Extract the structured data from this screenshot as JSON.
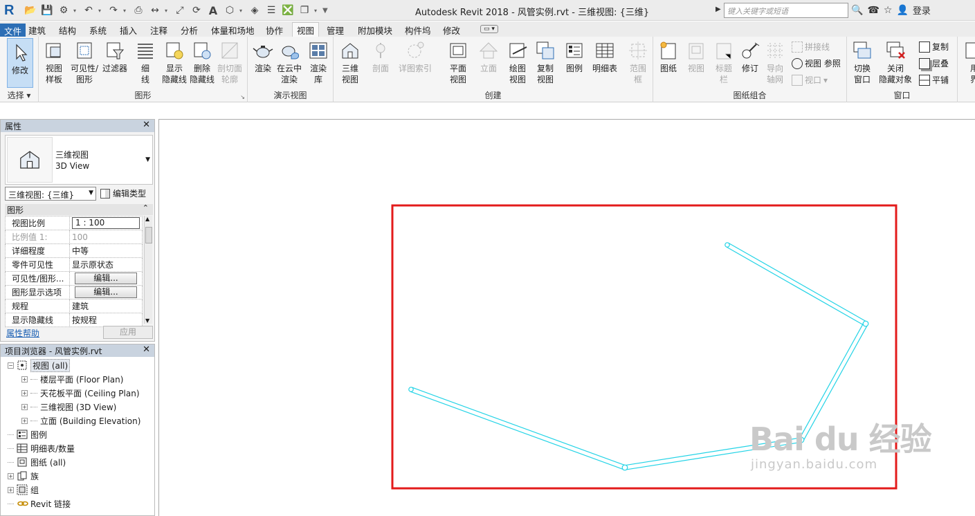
{
  "window": {
    "title": "Autodesk Revit 2018 -    风管实例.rvt - 三维视图: {三维}",
    "search_placeholder": "键入关键字或短语",
    "login": "登录"
  },
  "tabs": [
    "文件",
    "建筑",
    "结构",
    "系统",
    "插入",
    "注释",
    "分析",
    "体量和场地",
    "协作",
    "视图",
    "管理",
    "附加模块",
    "构件坞",
    "修改"
  ],
  "active_tab": "视图",
  "ribbon": {
    "panels": {
      "select": "选择",
      "graphics": "图形",
      "presentation": "演示视图",
      "create": "创建",
      "sheet": "图纸组合",
      "window": "窗口"
    },
    "buttons": {
      "modify": "修改",
      "view_templates": [
        "视图",
        "样板"
      ],
      "visibility": [
        "可见性/",
        "图形"
      ],
      "filters": "过滤器",
      "thin_lines": [
        "细",
        "线"
      ],
      "show_hidden": [
        "显示",
        "隐藏线"
      ],
      "remove_hidden": [
        "删除",
        "隐藏线"
      ],
      "cut_profile": [
        "剖切面",
        "轮廓"
      ],
      "render": "渲染",
      "render_cloud": [
        "在云中",
        "渲染"
      ],
      "render_gallery": [
        "渲染",
        "库"
      ],
      "view_3d": [
        "三维",
        "视图"
      ],
      "section": "剖面",
      "callout": "详图索引",
      "plan_views": [
        "平面",
        "视图"
      ],
      "elevation": "立面",
      "drafting_view": [
        "绘图",
        "视图"
      ],
      "duplicate_view": [
        "复制",
        "视图"
      ],
      "legends": "图例",
      "schedules": "明细表",
      "scope_box": [
        "范围",
        "框"
      ],
      "sheet": "图纸",
      "view": "视图",
      "title_block": [
        "标题",
        "栏"
      ],
      "revisions": "修订",
      "guide_grid": [
        "导向",
        "轴网"
      ],
      "matchline": "拼接线",
      "view_reference": "视图 参照",
      "viewports": "视口",
      "switch_windows": [
        "切换",
        "窗口"
      ],
      "close_hidden": [
        "关闭",
        "隐藏对象"
      ],
      "replicate": "复制",
      "cascade": "层叠",
      "tile": "平铺",
      "user_interface": [
        "用",
        "界"
      ]
    }
  },
  "properties": {
    "title": "属性",
    "type_name": [
      "三维视图",
      "3D View"
    ],
    "selector": "三维视图: {三维}",
    "edit_type": "编辑类型",
    "group": "图形",
    "rows": [
      {
        "key": "视图比例",
        "value": "1 : 100",
        "kind": "input"
      },
      {
        "key": "比例值 1:",
        "value": "100",
        "kind": "dim"
      },
      {
        "key": "详细程度",
        "value": "中等",
        "kind": "text"
      },
      {
        "key": "零件可见性",
        "value": "显示原状态",
        "kind": "text"
      },
      {
        "key": "可见性/图形...",
        "value": "编辑...",
        "kind": "button"
      },
      {
        "key": "图形显示选项",
        "value": "编辑...",
        "kind": "button"
      },
      {
        "key": "规程",
        "value": "建筑",
        "kind": "text"
      },
      {
        "key": "显示隐藏线",
        "value": "按规程",
        "kind": "text"
      }
    ],
    "help": "属性帮助",
    "apply": "应用"
  },
  "browser": {
    "title": "项目浏览器 - 风管实例.rvt",
    "items": [
      {
        "label": "视图 (all)",
        "level": 0,
        "toggle": "−",
        "icon": "views-icon",
        "selected": true
      },
      {
        "label": "楼层平面 (Floor Plan)",
        "level": 1,
        "toggle": "+"
      },
      {
        "label": "天花板平面 (Ceiling Plan)",
        "level": 1,
        "toggle": "+"
      },
      {
        "label": "三维视图 (3D View)",
        "level": 1,
        "toggle": "+"
      },
      {
        "label": "立面 (Building Elevation)",
        "level": 1,
        "toggle": "+"
      },
      {
        "label": "图例",
        "level": 0,
        "toggle": "",
        "icon": "legend-icon"
      },
      {
        "label": "明细表/数量",
        "level": 0,
        "toggle": "",
        "icon": "schedule-icon"
      },
      {
        "label": "图纸 (all)",
        "level": 0,
        "toggle": "",
        "icon": "sheet-icon"
      },
      {
        "label": "族",
        "level": 0,
        "toggle": "+",
        "icon": "family-icon"
      },
      {
        "label": "组",
        "level": 0,
        "toggle": "+",
        "icon": "group-icon"
      },
      {
        "label": "Revit 链接",
        "level": 0,
        "toggle": "",
        "icon": "link-icon"
      }
    ]
  },
  "viewport": {
    "duct_color": "#22d3e6",
    "highlight_color": "#e31b1b"
  },
  "watermark": {
    "text": "Bai du 经验",
    "url": "jingyan.baidu.com"
  }
}
